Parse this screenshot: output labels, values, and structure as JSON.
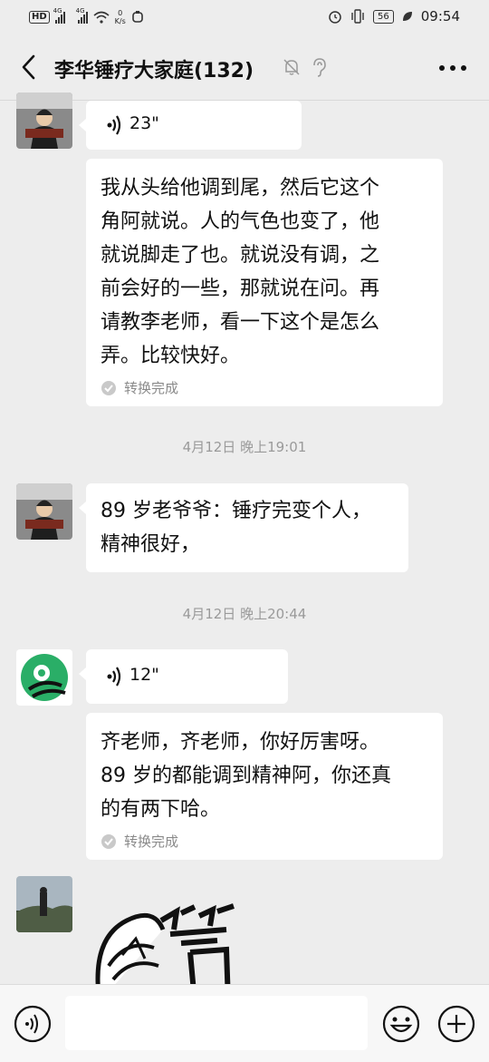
{
  "status_bar": {
    "hd": "HD",
    "signal1": "4G",
    "signal2": "4G",
    "net_speed_value": "0",
    "net_speed_unit": "K/s",
    "battery": "56",
    "time": "09:54"
  },
  "header": {
    "title": "李华锤疗大家庭(132)"
  },
  "messages": [
    {
      "type": "voice",
      "duration": "23\""
    },
    {
      "type": "text",
      "lines": [
        "我从头给他调到尾，然后它这个",
        "角阿就说。人的气色也变了，他",
        "就说脚走了也。就说没有调，之",
        "前会好的一些，那就说在问。再",
        "请教李老师，看一下这个是怎么",
        "弄。比较快好。"
      ],
      "status": "转换完成"
    },
    {
      "type": "timestamp",
      "text": "4月12日 晚上19:01"
    },
    {
      "type": "text",
      "lines": [
        "89 岁老爷爷：锤疗完变个人，",
        "精神很好，"
      ]
    },
    {
      "type": "timestamp",
      "text": "4月12日 晚上20:44"
    },
    {
      "type": "voice",
      "duration": "12\""
    },
    {
      "type": "text",
      "lines": [
        "齐老师，齐老师，你好厉害呀。",
        "89 岁的都能调到精神阿，你还真",
        "的有两下哈。"
      ],
      "status": "转换完成"
    },
    {
      "type": "sticker",
      "icon": "thumbs-up-sticker"
    }
  ],
  "colors": {
    "background": "#ededed",
    "bubble": "#ffffff",
    "wechat_green": "#2aae67"
  }
}
